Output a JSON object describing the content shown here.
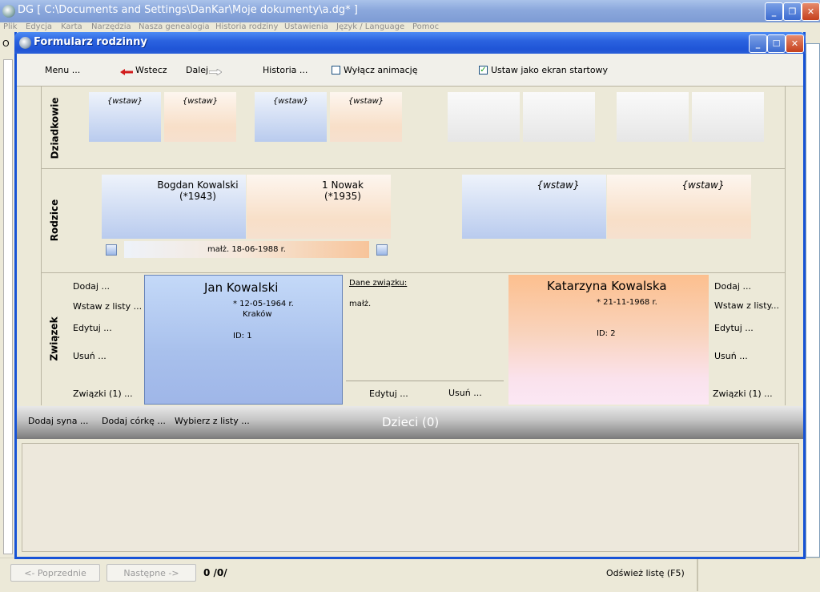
{
  "main_window": {
    "title": "DG [ C:\\Documents and Settings\\DanKar\\Moje dokumenty\\a.dg* ]",
    "menu": [
      "Plik",
      "Edycja",
      "Karta",
      "Narzędzia",
      "Nasza genealogia",
      "Historia rodziny",
      "Ustawienia",
      "Język / Language",
      "Pomoc"
    ],
    "tab_fragment": "O",
    "prev_button": "<- Poprzednie",
    "next_button": "Następne ->",
    "page_counter": "0 /0/",
    "refresh_button": "Odśwież listę (F5)"
  },
  "dialog": {
    "title": "Formularz rodzinny",
    "toolbar": {
      "menu": "Menu ...",
      "back": "Wstecz",
      "forward": "Dalej",
      "history": "Historia ...",
      "disable_animation": "Wyłącz animację",
      "disable_animation_checked": false,
      "start_screen": "Ustaw jako ekran startowy",
      "start_screen_checked": true
    },
    "grandparents": {
      "label": "Dziadkowie",
      "insert": "{wstaw}"
    },
    "parents": {
      "label": "Rodzice",
      "father_name": "Bogdan Kowalski",
      "father_birth": "(*1943)",
      "mother_name": "1 Nowak",
      "mother_birth": "(*1935)",
      "marriage": "małż. 18-06-1988 r.",
      "spouse_insert": "{wstaw}"
    },
    "union": {
      "label": "Związek",
      "left_actions": [
        "Dodaj ...",
        "Wstaw z listy ...",
        "Edytuj ...",
        "Usuń ..."
      ],
      "left_unions": "Związki (1) ...",
      "right_actions": [
        "Dodaj ...",
        "Wstaw z listy...",
        "Edytuj ...",
        "Usuń ..."
      ],
      "right_unions": "Związki (1) ...",
      "person1": {
        "name": "Jan Kowalski",
        "birth": "* 12-05-1964 r.",
        "place": "Kraków",
        "id": "ID: 1"
      },
      "person2": {
        "name": "Katarzyna Kowalska",
        "birth": "* 21-11-1968 r.",
        "id": "ID: 2"
      },
      "details_title": "Dane związku:",
      "details_type": "małż.",
      "edit": "Edytuj ...",
      "delete": "Usuń ..."
    },
    "children": {
      "add_son": "Dodaj syna ...",
      "add_daughter": "Dodaj córkę ...",
      "pick_from_list": "Wybierz z listy ...",
      "title": "Dzieci (0)"
    }
  }
}
